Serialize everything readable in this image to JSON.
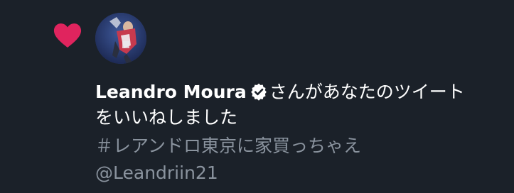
{
  "notification": {
    "user_name": "Leandro Moura",
    "action_line1": "さんがあなたのツイート",
    "action_line2": "をいいねしました",
    "tweet_text": "＃レアンドロ東京に家買っちゃえ",
    "handle": "@Leandriin21",
    "icons": {
      "like": "heart-icon",
      "verified": "verified-badge-icon"
    },
    "colors": {
      "background": "#1b2129",
      "heart": "#e0245e",
      "primary_text": "#ffffff",
      "secondary_text": "#8a939e"
    }
  }
}
